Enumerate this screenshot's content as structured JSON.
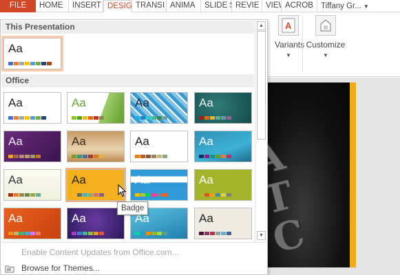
{
  "ribbon": {
    "tabs": [
      {
        "label": "FILE",
        "kind": "file"
      },
      {
        "label": "HOME",
        "kind": ""
      },
      {
        "label": "INSERT",
        "kind": ""
      },
      {
        "label": "DESIG",
        "kind": "active"
      },
      {
        "label": "TRANSI",
        "kind": ""
      },
      {
        "label": "ANIMA",
        "kind": ""
      },
      {
        "label": "SLIDE S",
        "kind": ""
      },
      {
        "label": "REVIE",
        "kind": ""
      },
      {
        "label": "VIEW",
        "kind": ""
      },
      {
        "label": "ACROB",
        "kind": ""
      }
    ],
    "user_label": "Tiffany Gr...",
    "variants_label": "Variants",
    "customize_label": "Customize"
  },
  "gallery": {
    "this_presentation_header": "This Presentation",
    "office_header": "Office",
    "tooltip": "Badge",
    "enable_updates_label": "Enable Content Updates from Office.com...",
    "browse_label": "Browse for Themes...",
    "current_theme": {
      "aa": "Aa",
      "bg": "#ffffff",
      "aa_color": "#222222",
      "colors": [
        "#4472c4",
        "#ed7d31",
        "#a5a5a5",
        "#ffc000",
        "#5b9bd5",
        "#70ad47",
        "#264478",
        "#9e480e"
      ]
    },
    "themes": [
      {
        "name": "office-theme",
        "aa": "Aa",
        "bg": "#ffffff",
        "aa_color": "#222222",
        "colors": [
          "#4472c4",
          "#ed7d31",
          "#a5a5a5",
          "#ffc000",
          "#5b9bd5",
          "#70ad47",
          "#264478"
        ]
      },
      {
        "name": "facet",
        "aa": "Aa",
        "bg": "linear-gradient(110deg,#ffffff 62%,#9fcc6b 62%,#5f9e2a 100%)",
        "aa_color": "#6aa532",
        "colors": [
          "#90c226",
          "#54a021",
          "#e6b91e",
          "#e76618",
          "#c42f1a",
          "#918655"
        ]
      },
      {
        "name": "integral",
        "aa": "Aa",
        "bg": "repeating-linear-gradient(45deg,#7fc3e6 0 5px,#ffffff 5px 7px,#3a9ad0 7px 12px)",
        "aa_color": "#1e2a3a",
        "colors": [
          "#1cade4",
          "#2683c6",
          "#27ced7",
          "#42ba97",
          "#3e8853",
          "#62a39f"
        ]
      },
      {
        "name": "ion-boardroom",
        "aa": "Aa",
        "bg": "radial-gradient(circle at 40% 40%,#2f7a78,#154c4a)",
        "aa_color": "#e8f4f2",
        "colors": [
          "#b01513",
          "#ea6312",
          "#e6b729",
          "#6aac90",
          "#5f9c9d",
          "#9e5e9b"
        ]
      },
      {
        "name": "ion",
        "aa": "Aa",
        "bg": "linear-gradient(135deg,#6a2a7a,#3a1450)",
        "aa_color": "#f0e6f6",
        "colors": [
          "#f0a22e",
          "#a5644e",
          "#b58b80",
          "#c3986d",
          "#a19574",
          "#c17529"
        ]
      },
      {
        "name": "organic",
        "aa": "Aa",
        "bg": "linear-gradient(180deg,#c79a64,#e9d3b0 60%,#c28a50)",
        "aa_color": "#3a2a1a",
        "colors": [
          "#83992a",
          "#3c9770",
          "#44709d",
          "#a23c33",
          "#d97828",
          "#deb340"
        ]
      },
      {
        "name": "retrospect",
        "aa": "Aa",
        "bg": "#ffffff",
        "aa_color": "#222222",
        "colors": [
          "#e48312",
          "#bd582c",
          "#865640",
          "#9b8357",
          "#c2bc80",
          "#94a088"
        ]
      },
      {
        "name": "slice",
        "aa": "Aa",
        "bg": "linear-gradient(160deg,#2e8fb4,#3db2d6 60%,#1f6c8c)",
        "aa_color": "#ffffff",
        "colors": [
          "#052f61",
          "#a50e82",
          "#14967c",
          "#6a9e1f",
          "#e87d37",
          "#c62d64"
        ]
      },
      {
        "name": "wisp",
        "aa": "Aa",
        "bg": "linear-gradient(180deg,#fbfbf0,#eef0dc)",
        "aa_color": "#333333",
        "colors": [
          "#a53010",
          "#de7e18",
          "#9f8351",
          "#728653",
          "#92aa4c",
          "#6aac91"
        ]
      },
      {
        "name": "badge",
        "aa": "Aa",
        "bg": "#f4b11d",
        "aa_color": "#222222",
        "colors": [
          "#f8b323",
          "#656a59",
          "#46b2b5",
          "#8caa7e",
          "#d36f68",
          "#826276"
        ]
      },
      {
        "name": "banded",
        "aa": "Aa",
        "bg": "linear-gradient(180deg,#2f9ad8 0 22%,#ffffff 22% 42%,#2f9ad8 42% 100%)",
        "aa_color": "#ffffff",
        "colors": [
          "#ffc000",
          "#a5d028",
          "#08cc78",
          "#f24099",
          "#828288",
          "#f56617"
        ]
      },
      {
        "name": "basis",
        "aa": "Aa",
        "bg": "#a4b32b",
        "aa_color": "#ffffff",
        "colors": [
          "#a6b727",
          "#df5327",
          "#fe9e00",
          "#418ab3",
          "#d7d447",
          "#818183"
        ]
      },
      {
        "name": "berlin",
        "aa": "Aa",
        "bg": "linear-gradient(135deg,#e8611e,#c8400e)",
        "aa_color": "#ffffff",
        "colors": [
          "#f09415",
          "#c1b56b",
          "#4baf73",
          "#5aa6c0",
          "#d17df9",
          "#fa7e5c"
        ]
      },
      {
        "name": "celestial",
        "aa": "Aa",
        "bg": "radial-gradient(circle at 50% 40%,#6a3aa2,#2a1a5a)",
        "aa_color": "#ffffff",
        "colors": [
          "#ac3ec1",
          "#477bd1",
          "#46b298",
          "#90ba4c",
          "#dd9d31",
          "#e25247"
        ]
      },
      {
        "name": "circuit",
        "aa": "Aa",
        "bg": "linear-gradient(160deg,#5cc3e0,#1e7fb0)",
        "aa_color": "#ffffff",
        "colors": [
          "#03d4a8",
          "#21a0c6",
          "#ee8c0c",
          "#9ab537",
          "#a6d35c",
          "#5b9b98"
        ]
      },
      {
        "name": "dividend",
        "aa": "Aa",
        "bg": "#efebe2",
        "aa_color": "#222222",
        "colors": [
          "#4d1434",
          "#903163",
          "#b2324b",
          "#969fa7",
          "#66b1ce",
          "#40619d"
        ]
      }
    ]
  }
}
